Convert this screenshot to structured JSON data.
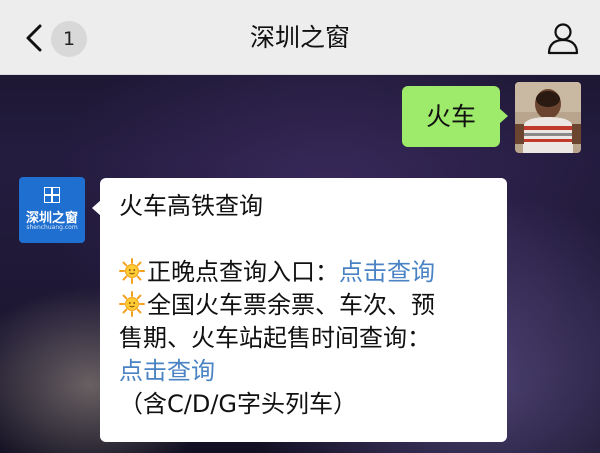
{
  "header": {
    "back_count": "1",
    "title": "深圳之窗"
  },
  "messages": {
    "sent": {
      "text": "火车"
    },
    "received": {
      "heading": "火车高铁查询",
      "item1_label": "正晚点查询入口：",
      "item1_link": "点击查询",
      "item2_line1": "全国火车票余票、车次、预",
      "item2_line2": "售期、火车站起售时间查询：",
      "item2_link": "点击查询",
      "note": "（含C/D/G字头列车）",
      "sun_icon": "sun-emoji-icon"
    }
  },
  "account_avatar": {
    "name": "深圳之窗",
    "url": "shenchuang.com",
    "color": "#1f6fd0"
  },
  "colors": {
    "sent_bubble": "#9eea6a",
    "link": "#4a83c4",
    "header_bg": "#ededed"
  }
}
